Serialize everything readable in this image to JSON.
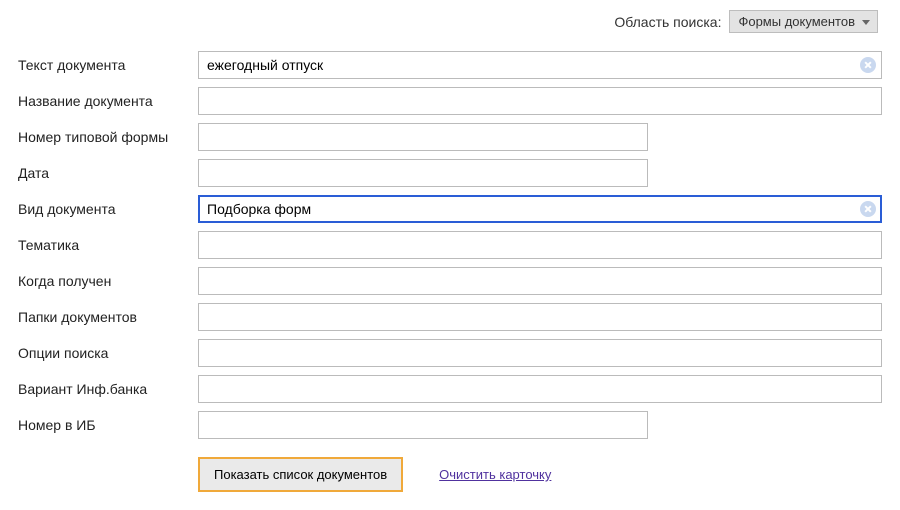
{
  "top": {
    "scope_label": "Область поиска:",
    "scope_value": "Формы документов"
  },
  "fields": {
    "text": {
      "label": "Текст документа",
      "value": "ежегодный отпуск",
      "has_clear": true,
      "width": "full",
      "focused": false
    },
    "name": {
      "label": "Название документа",
      "value": "",
      "has_clear": false,
      "width": "full",
      "focused": false
    },
    "formnum": {
      "label": "Номер типовой формы",
      "value": "",
      "has_clear": false,
      "width": "short",
      "focused": false
    },
    "date": {
      "label": "Дата",
      "value": "",
      "has_clear": false,
      "width": "short",
      "focused": false
    },
    "doctype": {
      "label": "Вид документа",
      "value": "Подборка форм",
      "has_clear": true,
      "width": "full",
      "focused": true
    },
    "topic": {
      "label": "Тематика",
      "value": "",
      "has_clear": false,
      "width": "full",
      "focused": false
    },
    "received": {
      "label": "Когда получен",
      "value": "",
      "has_clear": false,
      "width": "full",
      "focused": false
    },
    "folders": {
      "label": "Папки документов",
      "value": "",
      "has_clear": false,
      "width": "full",
      "focused": false
    },
    "options": {
      "label": "Опции поиска",
      "value": "",
      "has_clear": false,
      "width": "full",
      "focused": false
    },
    "bankvariant": {
      "label": "Вариант Инф.банка",
      "value": "",
      "has_clear": false,
      "width": "full",
      "focused": false
    },
    "ibnum": {
      "label": "Номер в ИБ",
      "value": "",
      "has_clear": false,
      "width": "short",
      "focused": false
    }
  },
  "actions": {
    "show_label": "Показать список документов",
    "clear_label": "Очистить карточку"
  }
}
